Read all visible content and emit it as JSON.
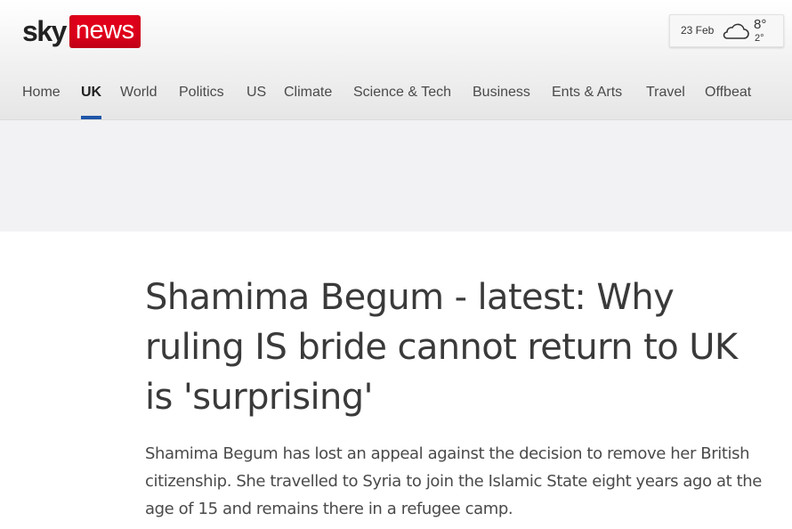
{
  "brand": {
    "sky": "sky",
    "news": "news",
    "accent": "#e0001b"
  },
  "weather": {
    "date": "23 Feb",
    "icon": "cloud-icon",
    "high": "8°",
    "low": "2°"
  },
  "nav": {
    "items": [
      "Home",
      "UK",
      "World",
      "Politics",
      "US",
      "Climate",
      "Science & Tech",
      "Business",
      "Ents & Arts",
      "Travel",
      "Offbeat"
    ],
    "active": "UK",
    "active_color": "#1f56a8"
  },
  "article": {
    "headline": "Shamima Begum - latest: Why ruling IS bride cannot return to UK is 'surprising'",
    "standfirst": "Shamima Begum has lost an appeal against the decision to remove her British citizenship. She travelled to Syria to join the Islamic State eight years ago at the age of 15 and remains there in a refugee camp."
  }
}
